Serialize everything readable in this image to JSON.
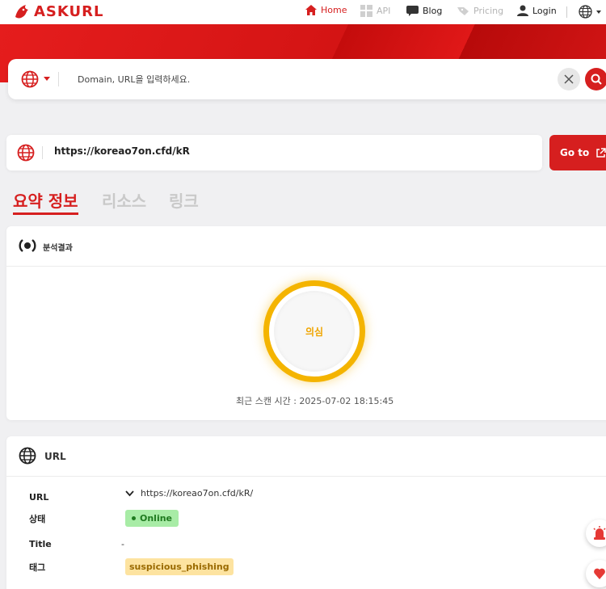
{
  "brand": {
    "name": "ASKURL",
    "color": "#d61f1f"
  },
  "nav": {
    "home": "Home",
    "api": "API",
    "blog": "Blog",
    "pricing": "Pricing",
    "login": "Login"
  },
  "search": {
    "placeholder": "Domain, URL을 입력하세요.",
    "value": ""
  },
  "url_bar": {
    "url": "https://koreao7on.cfd/kR",
    "goto_label": "Go to"
  },
  "tabs": [
    {
      "label": "요약 정보",
      "active": true
    },
    {
      "label": "리소스",
      "active": false
    },
    {
      "label": "링크",
      "active": false
    }
  ],
  "analysis": {
    "title": "분석결과",
    "verdict": "의심",
    "verdict_color": "#f4b400",
    "scan_time": "최근 스캔 시간 : 2025-07-02 18:15:45"
  },
  "url_info": {
    "title": "URL",
    "rows": [
      {
        "label": "URL",
        "value": "https://koreao7on.cfd/kR/"
      },
      {
        "label": "상태",
        "value": "Online"
      },
      {
        "label": "Title",
        "value": "-"
      },
      {
        "label": "태그",
        "value": "suspicious_phishing"
      }
    ]
  },
  "icons": [
    "logo-icon",
    "home-icon",
    "api-icon",
    "blog-icon",
    "pricing-icon",
    "user-icon",
    "globe-icon",
    "caret-down-icon",
    "close-icon",
    "search-icon",
    "external-link-icon",
    "analysis-icon",
    "chevron-down-icon",
    "alert-siren-icon",
    "help-chat-icon"
  ]
}
